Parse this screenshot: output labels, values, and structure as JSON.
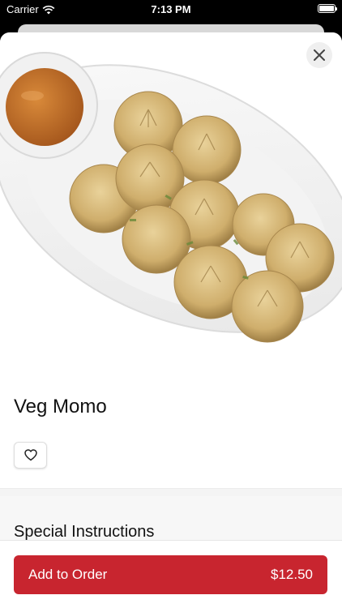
{
  "status_bar": {
    "carrier": "Carrier",
    "time": "7:13 PM"
  },
  "item": {
    "name": "Veg Momo",
    "image_icon": "momo-plate-photo"
  },
  "actions": {
    "close_icon": "close-icon",
    "favorite_icon": "heart-icon"
  },
  "special_instructions": {
    "title": "Special Instructions"
  },
  "order": {
    "button_label": "Add to Order",
    "price": "$12.50"
  },
  "colors": {
    "accent": "#c8252f"
  }
}
